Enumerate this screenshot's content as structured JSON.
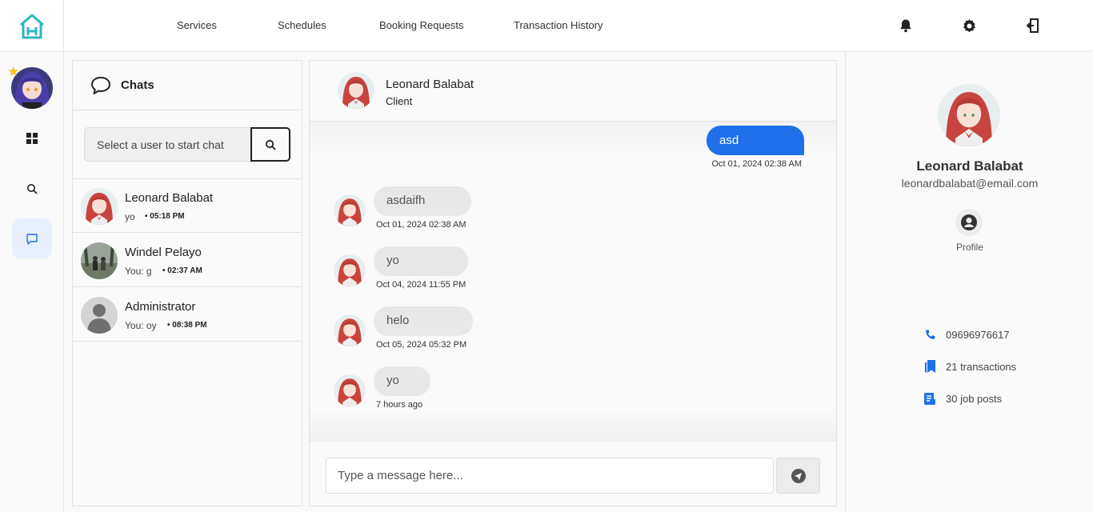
{
  "nav": {
    "links": [
      "Services",
      "Schedules",
      "Booking Requests",
      "Transaction History"
    ]
  },
  "chat_list": {
    "title": "Chats",
    "search_placeholder": "Select a user to start chat",
    "contacts": [
      {
        "name": "Leonard Balabat",
        "preview": "yo",
        "time": "• 05:18 PM"
      },
      {
        "name": "Windel Pelayo",
        "preview": "You: g",
        "time": "• 02:37 AM"
      },
      {
        "name": "Administrator",
        "preview": "You: oy",
        "time": "• 08:38 PM"
      }
    ]
  },
  "conversation": {
    "name": "Leonard Balabat",
    "role": "Client",
    "outgoing": {
      "text": "asd",
      "time": "Oct 01, 2024 02:38 AM"
    },
    "incoming": [
      {
        "text": "asdaifh",
        "time": "Oct 01, 2024 02:38 AM"
      },
      {
        "text": "yo",
        "time": "Oct 04, 2024 11:55 PM"
      },
      {
        "text": "helo",
        "time": "Oct 05, 2024 05:32 PM"
      },
      {
        "text": "yo",
        "time": "7 hours ago"
      }
    ],
    "input_placeholder": "Type a message here..."
  },
  "profile": {
    "name": "Leonard Balabat",
    "email": "leonardbalabat@email.com",
    "profile_label": "Profile",
    "phone": "09696976617",
    "transactions": "21 transactions",
    "job_posts": "30 job posts"
  },
  "colors": {
    "accent": "#1f6feb",
    "logo": "#2bb5c5"
  }
}
